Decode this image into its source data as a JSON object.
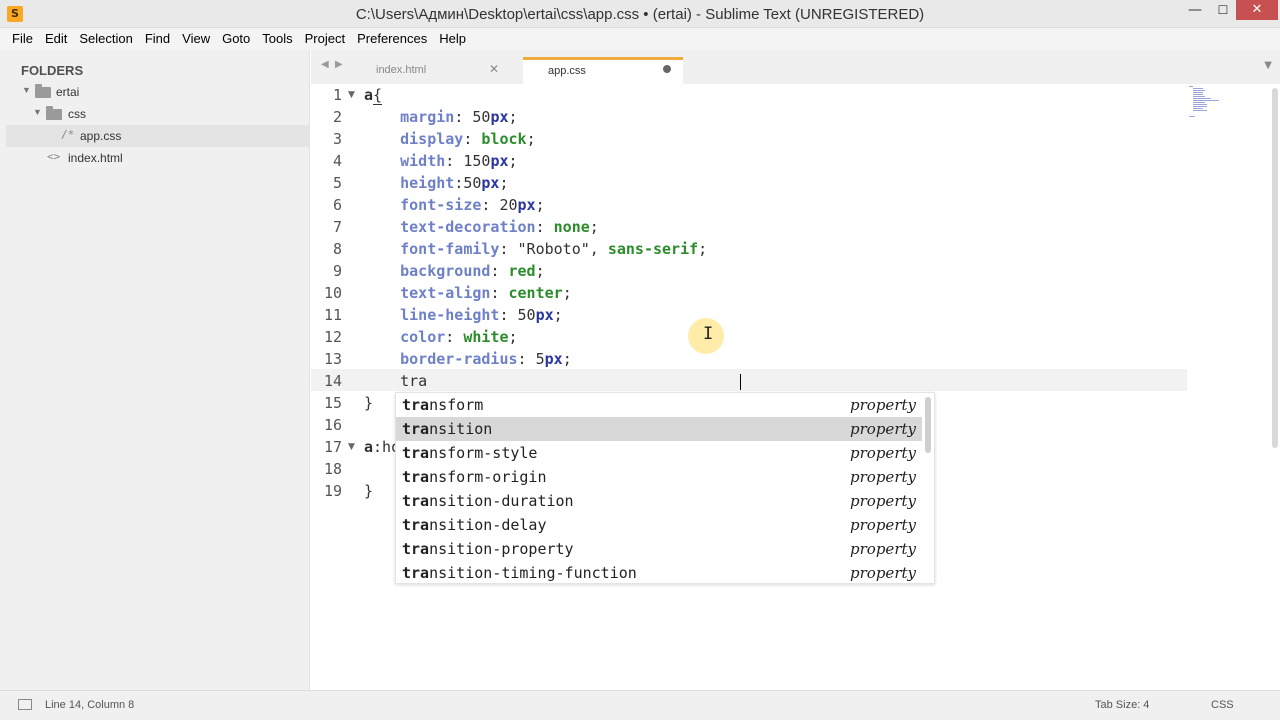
{
  "window": {
    "title": "C:\\Users\\Админ\\Desktop\\ertai\\css\\app.css • (ertai) - Sublime Text (UNREGISTERED)",
    "app_icon": "S",
    "minimize": "—",
    "maximize": "☐",
    "close": "✕"
  },
  "menu": [
    "File",
    "Edit",
    "Selection",
    "Find",
    "View",
    "Goto",
    "Tools",
    "Project",
    "Preferences",
    "Help"
  ],
  "sidebar": {
    "heading": "FOLDERS",
    "items": [
      {
        "label": "ertai",
        "kind": "folder"
      },
      {
        "label": "css",
        "kind": "folder"
      },
      {
        "label": "app.css",
        "kind": "file",
        "glyph": "/*",
        "selected": true
      },
      {
        "label": "index.html",
        "kind": "file",
        "glyph": "<>"
      }
    ]
  },
  "tabs": {
    "nav_left": "◀",
    "nav_right": "▶",
    "items": [
      {
        "label": "index.html",
        "close": "✕"
      },
      {
        "label": "app.css",
        "dirty": true
      }
    ],
    "overflow": "▼"
  },
  "editor": {
    "line_numbers": [
      "1",
      "2",
      "3",
      "4",
      "5",
      "6",
      "7",
      "8",
      "9",
      "10",
      "11",
      "12",
      "13",
      "14",
      "15",
      "16",
      "17",
      "18",
      "19"
    ],
    "fold_markers": [
      "▼",
      "▼"
    ],
    "code": {
      "l1_sel": "a",
      "l1_brace": "{",
      "l2_prop": "margin",
      "l2_num": "50",
      "l2_unit": "px",
      "l3_prop": "display",
      "l3_val": "block",
      "l4_prop": "width",
      "l4_num": "150",
      "l4_unit": "px",
      "l5_prop": "height",
      "l5_num": "50",
      "l5_unit": "px",
      "l6_prop": "font-size",
      "l6_num": "20",
      "l6_unit": "px",
      "l7_prop": "text-decoration",
      "l7_val": "none",
      "l8_prop": "font-family",
      "l8_str": "\"Roboto\"",
      "l8_val": "sans-serif",
      "l9_prop": "background",
      "l9_val": "red",
      "l10_prop": "text-align",
      "l10_val": "center",
      "l11_prop": "line-height",
      "l11_num": "50",
      "l11_unit": "px",
      "l12_prop": "color",
      "l12_val": "white",
      "l13_prop": "border-radius",
      "l13_num": "5",
      "l13_unit": "px",
      "l14_text": "tra",
      "l15_text": "}",
      "l17_sel": "a",
      "l17_rest": ":ho",
      "l19_text": "}"
    },
    "mouse_cursor": "I"
  },
  "autocomplete": {
    "typed": "tra",
    "items": [
      {
        "rest": "nsform",
        "type": "property"
      },
      {
        "rest": "nsition",
        "type": "property",
        "selected": true
      },
      {
        "rest": "nsform-style",
        "type": "property"
      },
      {
        "rest": "nsform-origin",
        "type": "property"
      },
      {
        "rest": "nsition-duration",
        "type": "property"
      },
      {
        "rest": "nsition-delay",
        "type": "property"
      },
      {
        "rest": "nsition-property",
        "type": "property"
      },
      {
        "rest": "nsition-timing-function",
        "type": "property"
      }
    ]
  },
  "statusbar": {
    "position": "Line 14, Column 8",
    "tab_size": "Tab Size: 4",
    "syntax": "CSS"
  },
  "colors": {
    "tab_accent": "#f0ab3c",
    "property": "#6e80c8",
    "value": "#2c8c2c",
    "unit": "#2a36a0",
    "close_button": "#c75050"
  }
}
